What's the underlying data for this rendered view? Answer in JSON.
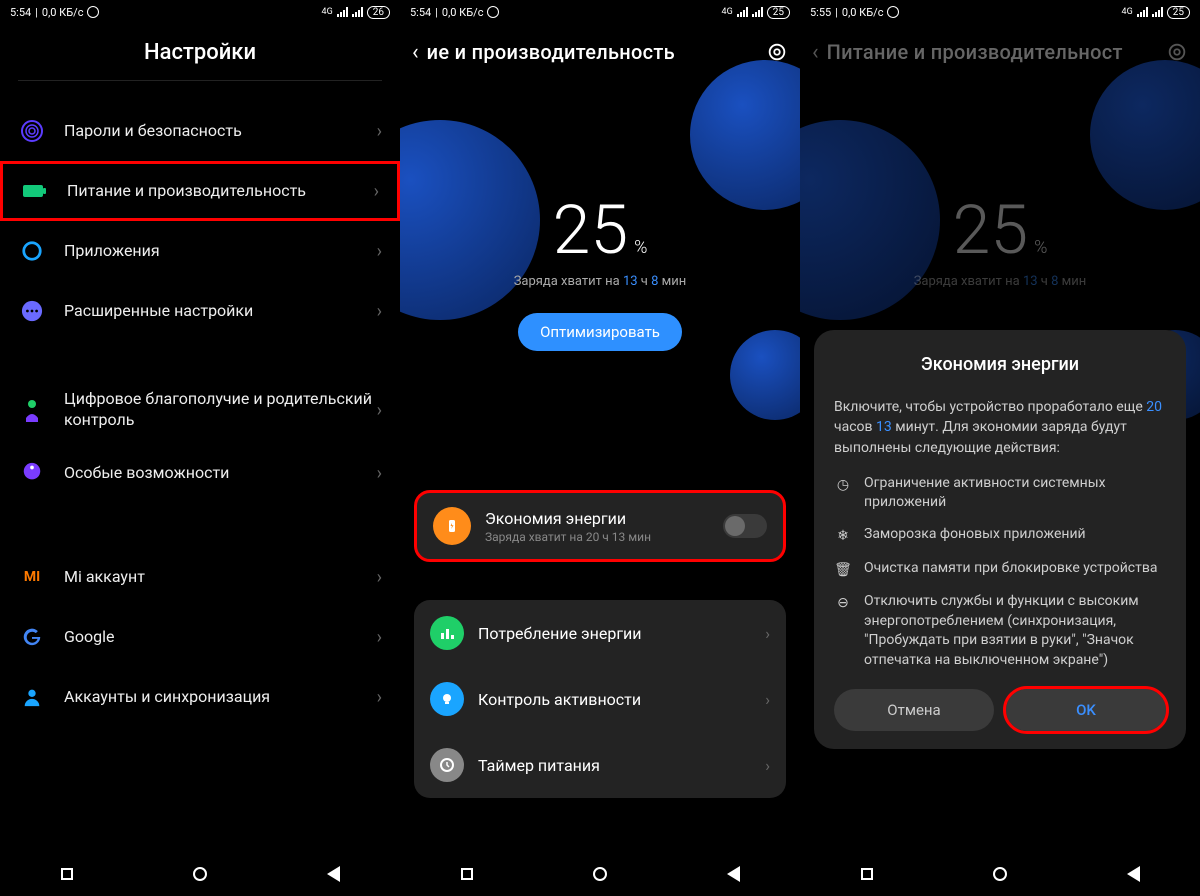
{
  "status1": {
    "time": "5:54",
    "speed": "0,0 КБ/с",
    "net": "4G",
    "battery": "26"
  },
  "status2": {
    "time": "5:54",
    "speed": "0,0 КБ/с",
    "net": "4G",
    "battery": "25"
  },
  "status3": {
    "time": "5:55",
    "speed": "0,0 КБ/с",
    "net": "4G",
    "battery": "25"
  },
  "pane1": {
    "title": "Настройки",
    "items": [
      {
        "label": "Пароли и безопасность",
        "icon": "fingerprint",
        "color": "#5b3cff"
      },
      {
        "label": "Питание и производительность",
        "icon": "battery",
        "color": "#12c97a"
      },
      {
        "label": "Приложения",
        "icon": "gear",
        "color": "#1aa5ff"
      },
      {
        "label": "Расширенные настройки",
        "icon": "dots",
        "color": "#6a6aff"
      },
      {
        "label": "Цифровое благополучие и родительский контроль",
        "icon": "wellbeing",
        "color": "#1fcf68"
      },
      {
        "label": "Особые возможности",
        "icon": "accessibility",
        "color": "#7a3cff"
      },
      {
        "label": "Mi аккаунт",
        "icon": "mi",
        "color": "#ff7a00"
      },
      {
        "label": "Google",
        "icon": "google",
        "color": ""
      },
      {
        "label": "Аккаунты и синхронизация",
        "icon": "person",
        "color": "#1aa5ff"
      }
    ]
  },
  "pane2": {
    "title": "ие и производительность",
    "battery_pct": "25",
    "pct_unit": "%",
    "remaining_prefix": "Заряда хватит на ",
    "remaining_h": "13",
    "hour_unit": "ч",
    "remaining_m": "8",
    "min_unit": "мин",
    "optimize": "Оптимизировать",
    "energy": {
      "title": "Экономия энергии",
      "sub": "Заряда хватит на 20 ч 13 мин"
    },
    "list": [
      {
        "label": "Потребление энергии",
        "color": "#1fcf68"
      },
      {
        "label": "Контроль активности",
        "color": "#1aa5ff"
      },
      {
        "label": "Таймер питания",
        "color": "#888888"
      }
    ]
  },
  "pane3": {
    "title": "Питание и производительност",
    "battery_pct": "25",
    "pct_unit": "%",
    "remaining_prefix": "Заряда хватит на ",
    "remaining_h": "13",
    "hour_unit": "ч",
    "remaining_m": "8",
    "min_unit": "мин",
    "dialog": {
      "title": "Экономия энергии",
      "body_pre": "Включите, чтобы устройство проработало еще ",
      "hours": "20",
      "hours_label": " часов ",
      "mins": "13",
      "mins_label": " минут. ",
      "body_post": "Для экономии заряда будут выполнены следующие действия:",
      "items": [
        "Ограничение активности системных приложений",
        "Заморозка фоновых приложений",
        "Очистка памяти при блокировке устройства",
        "Отключить службы и функции с высоким энергопотреблением (синхронизация, \"Пробуждать при взятии в руки\", \"Значок отпечатка на выключенном экране\")"
      ],
      "cancel": "Отмена",
      "ok": "OK"
    }
  }
}
